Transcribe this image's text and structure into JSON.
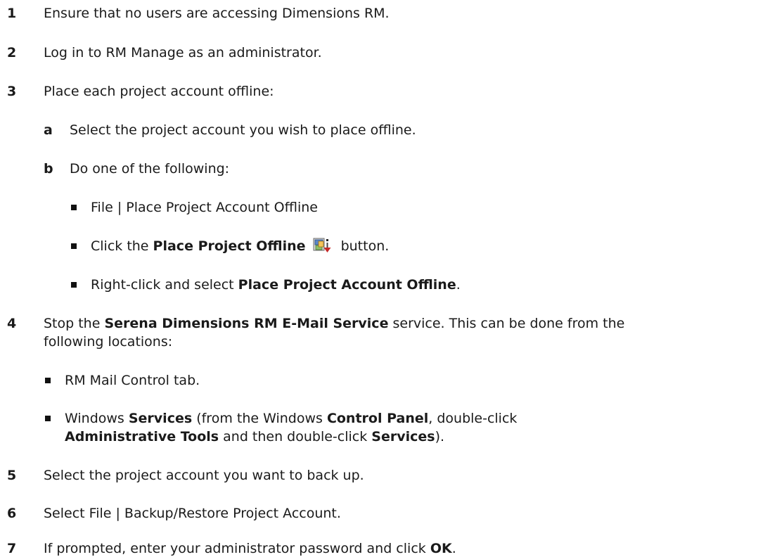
{
  "steps": {
    "s1": {
      "num": "1",
      "text": "Ensure that no users are accessing Dimensions RM."
    },
    "s2": {
      "num": "2",
      "text": "Log in to RM Manage as an administrator."
    },
    "s3": {
      "num": "3",
      "text": "Place each project account offline:",
      "a": {
        "letter": "a",
        "text": "Select the project account you wish to place offline."
      },
      "b": {
        "letter": "b",
        "text": "Do one of the following:",
        "bullets": {
          "b1": {
            "text": "File | Place Project Account Offline"
          },
          "b2": {
            "pre": "Click the ",
            "bold": "Place Project Offline",
            "post": "button.",
            "icon": "place-project-offline-icon"
          },
          "b3": {
            "pre": "Right-click and select ",
            "bold": "Place Project Account Offline",
            "post": "."
          }
        }
      }
    },
    "s4": {
      "num": "4",
      "pre": "Stop the ",
      "bold": "Serena Dimensions RM E-Mail Service",
      "post": " service. This can be done from the",
      "line2": "following locations:",
      "bullets": {
        "b1": {
          "text": "RM Mail Control tab."
        },
        "b2": {
          "p1": "Windows ",
          "b1": "Services",
          "p2": " (from the Windows ",
          "b2": "Control Panel",
          "p3": ", double-click",
          "b3": "Administrative Tools",
          "p4": " and then double-click ",
          "b4": "Services",
          "p5": ")."
        }
      }
    },
    "s5": {
      "num": "5",
      "text": "Select the project account you want to back up."
    },
    "s6": {
      "num": "6",
      "text": "Select File | Backup/Restore Project Account."
    },
    "s7": {
      "num": "7",
      "pre": "If prompted, enter your administrator password and click ",
      "bold": "OK",
      "post": "."
    }
  }
}
